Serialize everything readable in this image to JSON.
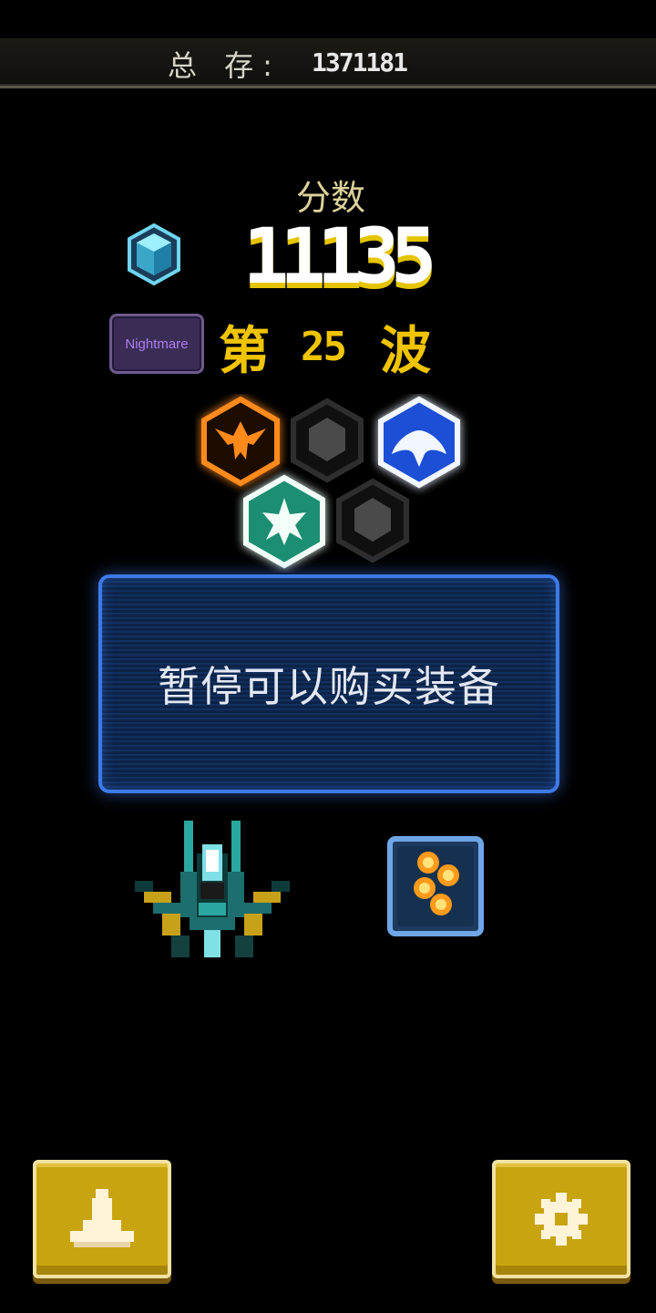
{
  "topbar": {
    "total_label": "总 存:",
    "total_value": "1371181"
  },
  "score": {
    "label": "分数",
    "value": "11135"
  },
  "difficulty": {
    "label": "Nightmare"
  },
  "wave": {
    "prefix": "第",
    "number": "25",
    "suffix": "波"
  },
  "emblems": [
    {
      "name": "phoenix-icon",
      "state": "active",
      "color": "#ff8a1e"
    },
    {
      "name": "empty-slot",
      "state": "locked",
      "color": "#555555"
    },
    {
      "name": "manta-icon",
      "state": "active",
      "color": "#2a6cff"
    },
    {
      "name": "ship-star-icon",
      "state": "active",
      "color": "#2fd3a0"
    },
    {
      "name": "empty-slot",
      "state": "locked",
      "color": "#555555"
    }
  ],
  "panel": {
    "message": "暂停可以购买装备"
  },
  "buttons": {
    "hangar": "ship-icon",
    "settings": "gear-icon"
  },
  "colors": {
    "accent_yellow": "#f0c400",
    "panel_blue": "#3d7be8",
    "button_gold": "#c9a411"
  }
}
